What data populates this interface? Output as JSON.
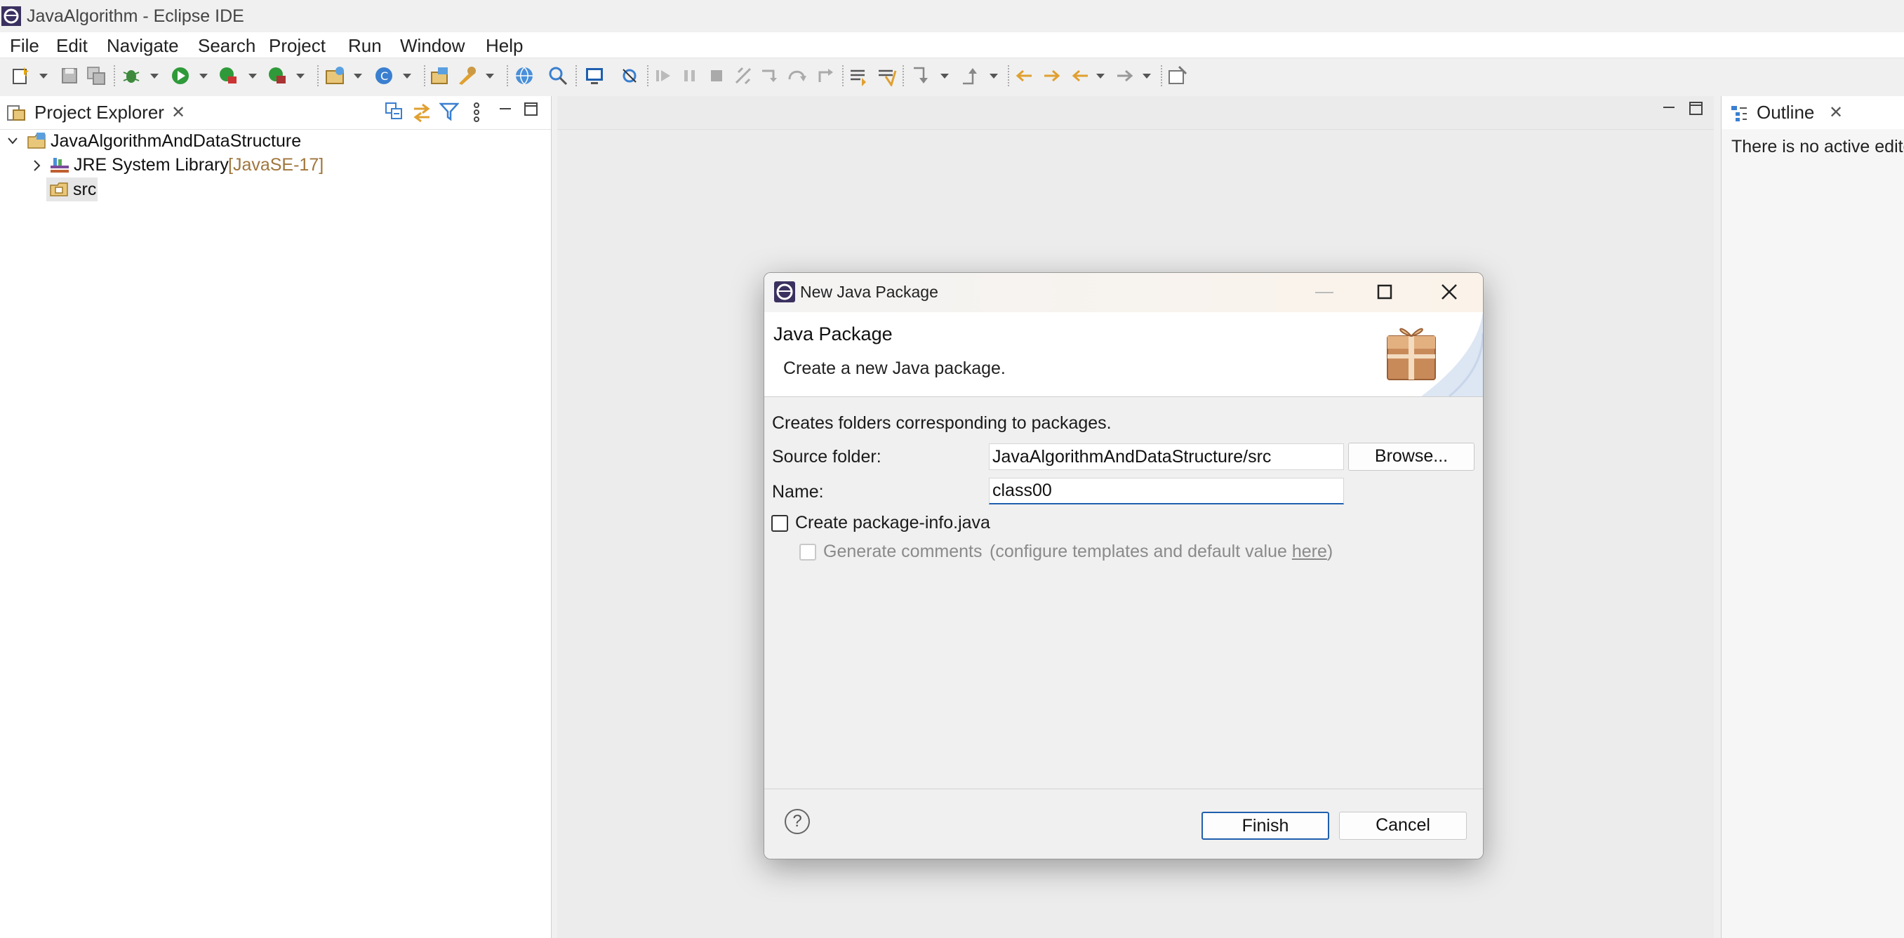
{
  "window": {
    "title": "JavaAlgorithm - Eclipse IDE"
  },
  "menu": [
    "File",
    "Edit",
    "Navigate",
    "Search",
    "Project",
    "Run",
    "Window",
    "Help"
  ],
  "project_explorer": {
    "title": "Project Explorer",
    "tree": {
      "project": "JavaAlgorithmAndDataStructure",
      "jre_label": "JRE System Library",
      "jre_version": "[JavaSE-17]",
      "src": "src"
    }
  },
  "outline": {
    "title": "Outline",
    "message": "There is no active editor"
  },
  "dialog": {
    "title": "New Java Package",
    "heading": "Java Package",
    "description": "Create a new Java package.",
    "info": "Creates folders corresponding to packages.",
    "source_folder_label": "Source folder:",
    "source_folder_value": "JavaAlgorithmAndDataStructure/src",
    "browse_label": "Browse...",
    "name_label": "Name:",
    "name_value": "class00",
    "create_package_info_label": "Create package-info.java",
    "generate_comments_label": "Generate comments",
    "configure_text": "(configure templates and default value ",
    "here_link": "here",
    "close_paren": ")",
    "finish_label": "Finish",
    "cancel_label": "Cancel",
    "help_symbol": "?"
  },
  "colors": {
    "accent": "#1f5fae",
    "jre_version": "#a0763c",
    "focus_underline": "#1f5fae"
  }
}
